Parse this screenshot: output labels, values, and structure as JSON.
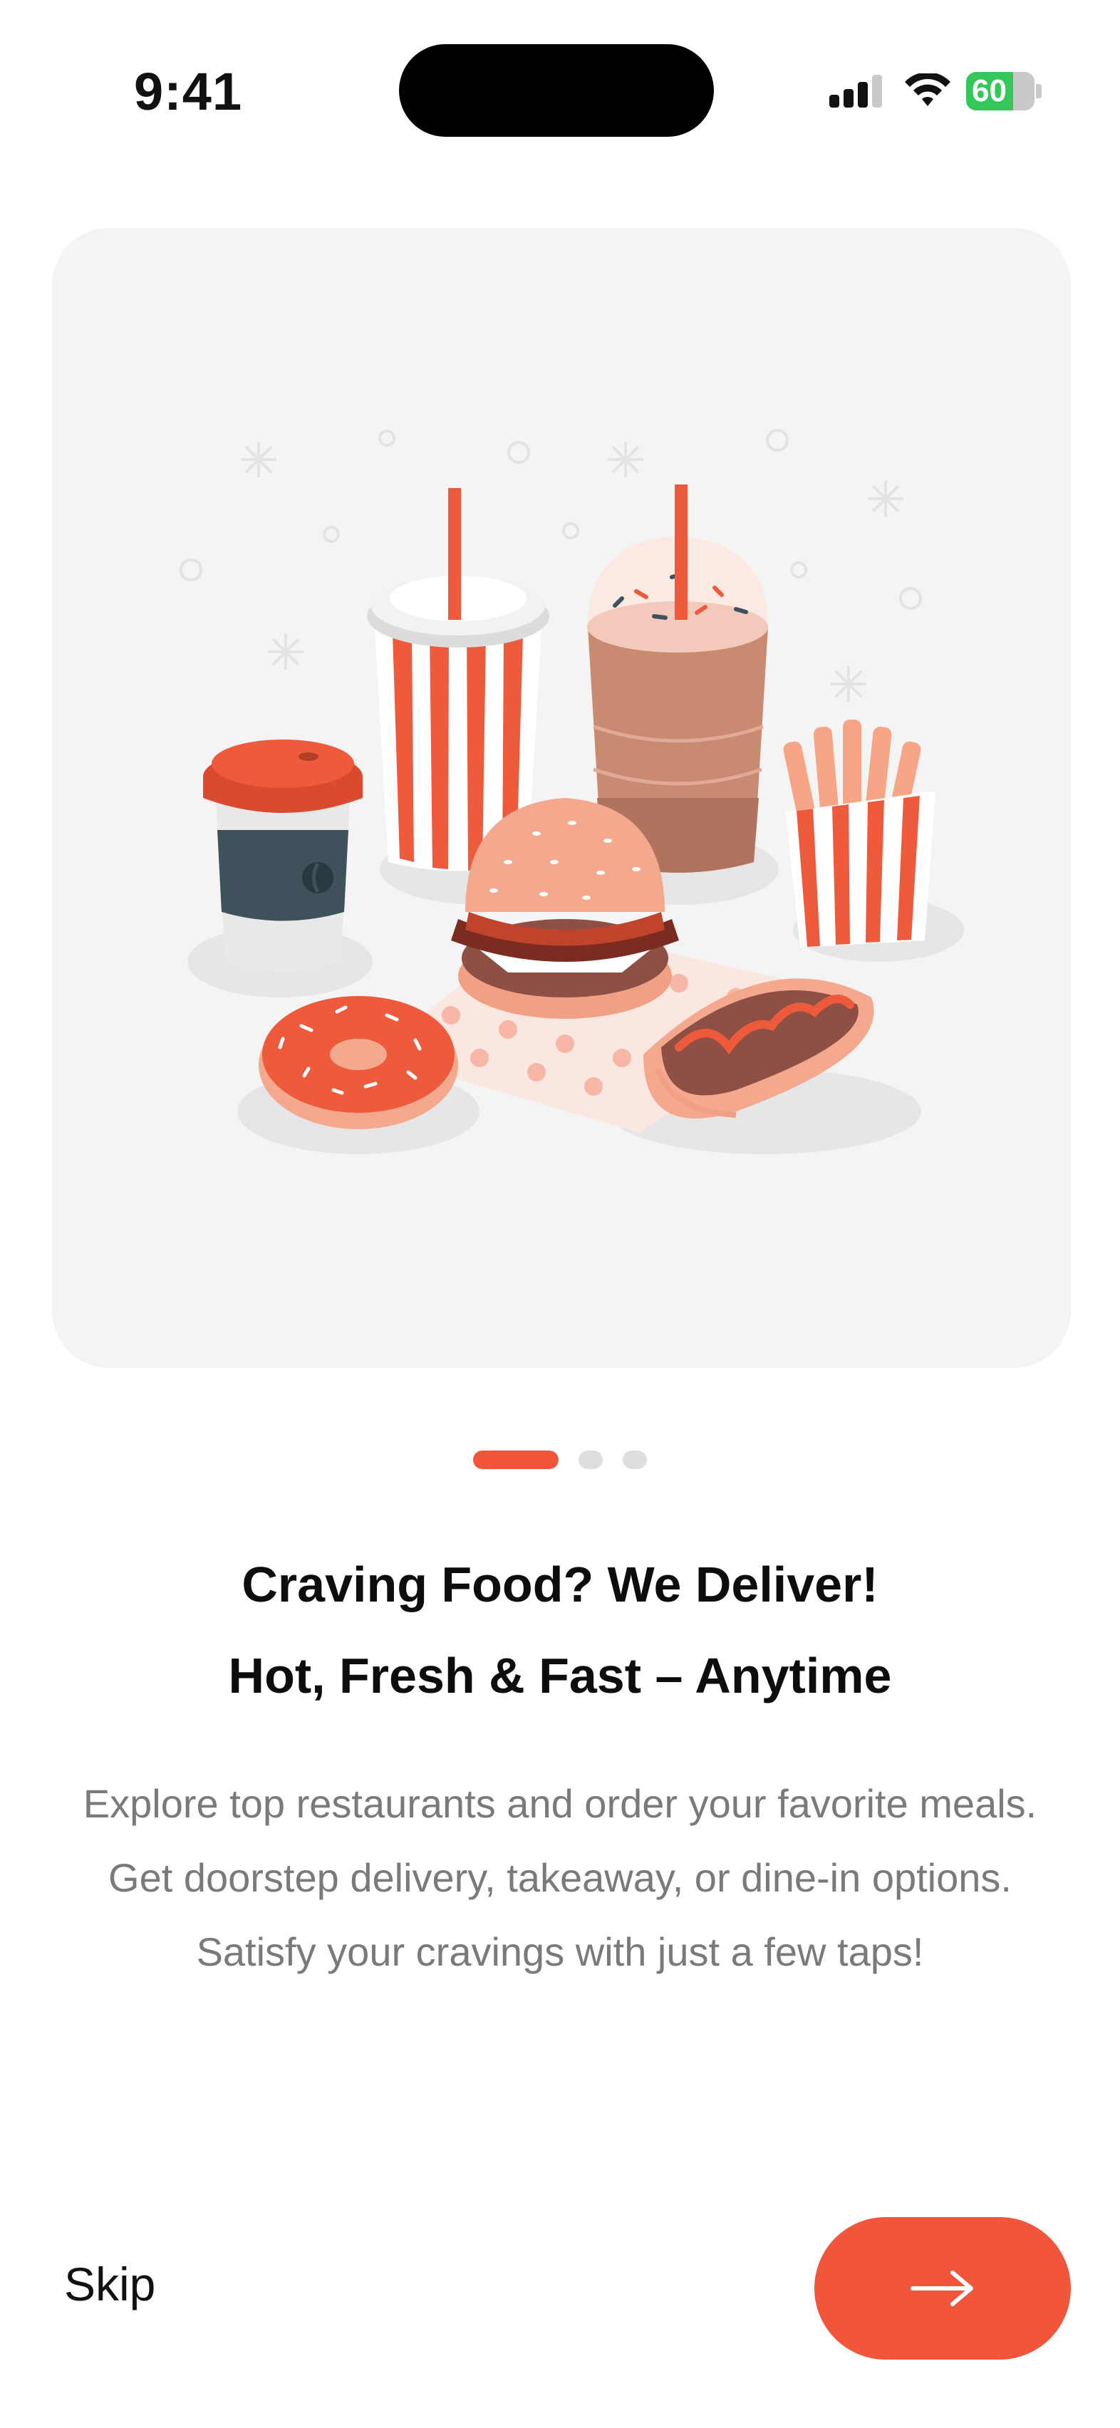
{
  "status_bar": {
    "time": "9:41",
    "battery": "60",
    "icons": [
      "signal-icon",
      "wifi-icon",
      "battery-icon"
    ]
  },
  "hero": {
    "illustration": "fast-food-illustration",
    "items": [
      "coffee-cup",
      "soda-cup",
      "milkshake",
      "fries",
      "burger",
      "donut",
      "hot-dog"
    ]
  },
  "pager": {
    "current": 1,
    "total": 3
  },
  "onboarding": {
    "title_line1": "Craving Food? We Deliver!",
    "title_line2": "Hot, Fresh & Fast – Anytime",
    "description": "Explore top restaurants and order your favorite meals. Get doorstep delivery, takeaway, or dine-in options. Satisfy your cravings with just a few taps!"
  },
  "actions": {
    "skip_label": "Skip",
    "next_icon": "arrow-right-icon"
  },
  "colors": {
    "accent": "#f1553a",
    "card_bg": "#f4f4f4",
    "body_text": "#7a7a7a",
    "inactive_dot": "#dedede"
  }
}
